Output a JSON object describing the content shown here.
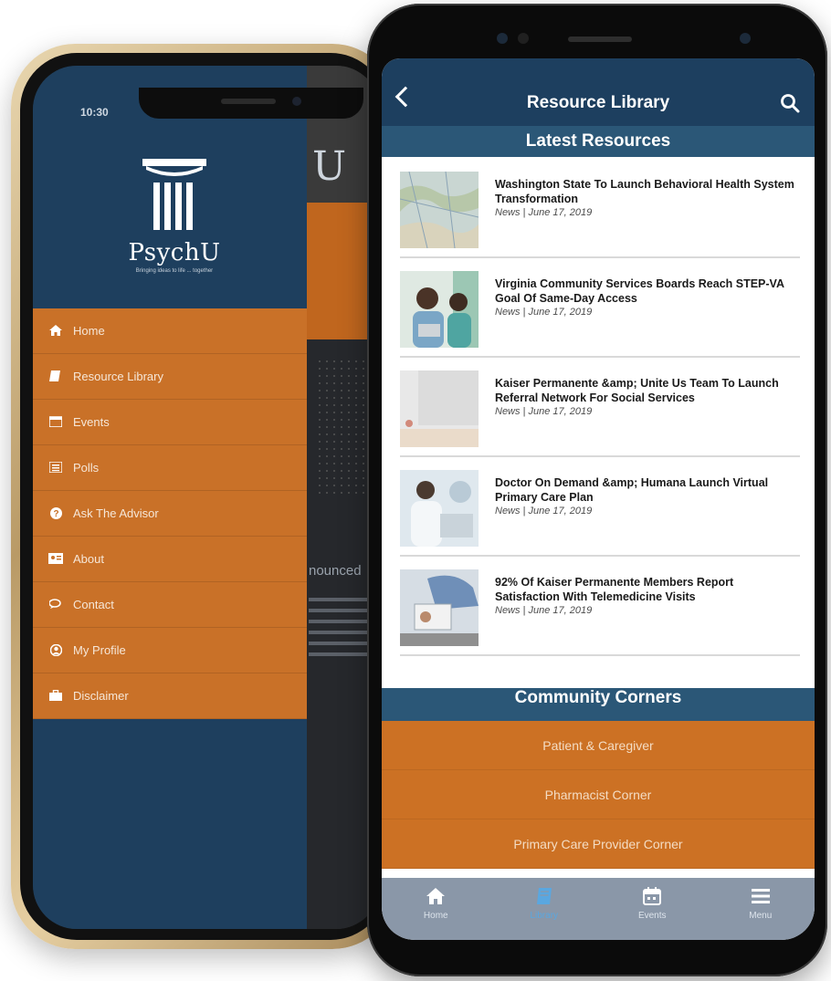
{
  "back_phone": {
    "status_time": "10:30",
    "brand": "PsychU",
    "brand_tagline": "Bringing ideas to life ... together",
    "background_snippet": "nounced",
    "menu": [
      {
        "label": "Home",
        "icon": "home-icon"
      },
      {
        "label": "Resource Library",
        "icon": "book-icon"
      },
      {
        "label": "Events",
        "icon": "calendar-icon"
      },
      {
        "label": "Polls",
        "icon": "list-icon"
      },
      {
        "label": "Ask The Advisor",
        "icon": "question-icon"
      },
      {
        "label": "About",
        "icon": "id-card-icon"
      },
      {
        "label": "Contact",
        "icon": "chat-icon"
      },
      {
        "label": "My Profile",
        "icon": "user-icon"
      },
      {
        "label": "Disclaimer",
        "icon": "briefcase-icon"
      }
    ]
  },
  "front_phone": {
    "header_title": "Resource Library",
    "latest_title": "Latest Resources",
    "news": [
      {
        "title": "Washington State To Launch Behavioral Health System Transformation",
        "meta": "News | June 17, 2019"
      },
      {
        "title": "Virginia Community Services Boards Reach STEP-VA Goal Of Same-Day Access",
        "meta": "News | June 17, 2019"
      },
      {
        "title": "Kaiser Permanente &amp; Unite Us Team To Launch Referral Network For Social Services",
        "meta": "News | June 17, 2019"
      },
      {
        "title": "Doctor On Demand &amp; Humana Launch Virtual Primary Care Plan",
        "meta": "News | June 17, 2019"
      },
      {
        "title": "92% Of Kaiser Permanente Members Report Satisfaction With Telemedicine Visits",
        "meta": "News | June 17, 2019"
      }
    ],
    "community_title": "Community Corners",
    "community_items": [
      "Patient & Caregiver",
      "Pharmacist Corner",
      "Primary Care Provider Corner"
    ],
    "tabs": [
      {
        "label": "Home",
        "icon": "home-icon"
      },
      {
        "label": "Library",
        "icon": "library-icon"
      },
      {
        "label": "Events",
        "icon": "calendar-icon"
      },
      {
        "label": "Menu",
        "icon": "menu-icon"
      }
    ],
    "active_tab": "Library",
    "colors": {
      "navy": "#1d3f5f",
      "section_blue": "#2b5777",
      "orange": "#cc7124",
      "tab_bg": "#8a97a8",
      "active_tab": "#5aa7e0"
    }
  }
}
